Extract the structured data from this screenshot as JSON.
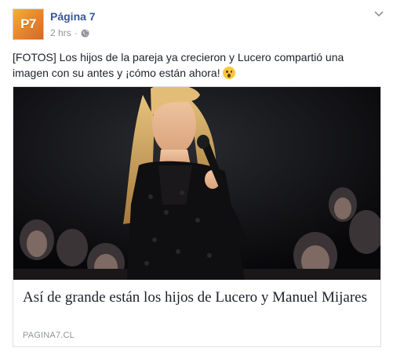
{
  "post": {
    "page_name": "Página 7",
    "avatar_text": "P7",
    "time": "2 hrs",
    "separator": "·",
    "privacy_icon": "globe-icon",
    "menu_icon": "chevron-down-icon",
    "message": "[FOTOS] Los hijos de la pareja ya crecieron y Lucero compartió una imagen con su antes y ¡cómo están ahora!",
    "emoji": "surprised-face-emoji"
  },
  "link_card": {
    "title": "Así de grande están los hijos de Lucero y Manuel Mijares",
    "domain": "PAGINA7.CL"
  },
  "colors": {
    "name": "#365899",
    "meta": "#90949c",
    "text": "#1d2129",
    "border": "#dddfe2",
    "avatar": "#e98a2c"
  }
}
